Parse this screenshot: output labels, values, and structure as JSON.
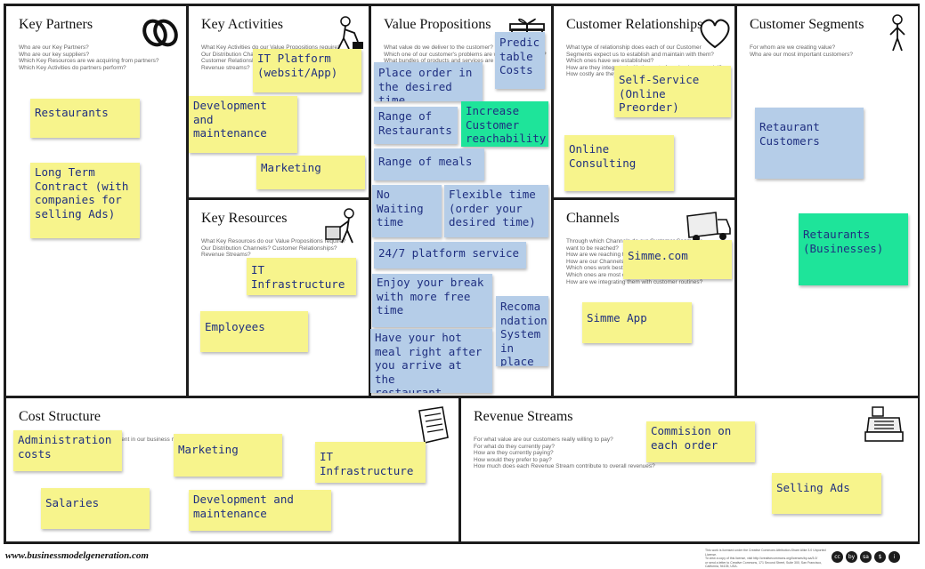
{
  "canvas": {
    "sections": {
      "key_partners": {
        "title": "Key Partners",
        "questions": "Who are our Key Partners?\nWho are our key suppliers?\nWhich Key Resources are we acquiring from partners?\nWhich Key Activities do partners perform?"
      },
      "key_activities": {
        "title": "Key Activities",
        "questions": "What Key Activities do our Value Propositions require?\nOur Distribution Channels?\nCustomer Relationships?\nRevenue streams?"
      },
      "value_propositions": {
        "title": "Value Propositions",
        "questions": "What value do we deliver to the customer?\nWhich one of our customer's problems are we helping to solve?\nWhat bundles of products and services are we offering to each Customer Segment?"
      },
      "customer_relationships": {
        "title": "Customer Relationships",
        "questions": "What type of relationship does each of our Customer\nSegments expect us to establish and maintain with them?\nWhich ones have we established?\nHow are they integrated with the rest of our business model?\nHow costly are they?"
      },
      "customer_segments": {
        "title": "Customer Segments",
        "questions": "For whom are we creating value?\nWho are our most important customers?"
      },
      "key_resources": {
        "title": "Key Resources",
        "questions": "What Key Resources do our Value Propositions require?\nOur Distribution Channels? Customer Relationships?\nRevenue Streams?"
      },
      "channels": {
        "title": "Channels",
        "questions": "Through which Channels do our Customer Segments\nwant to be reached?\nHow are we reaching them now?\nHow are our Channels integrated?\nWhich ones work best?\nWhich ones are most cost-efficient?\nHow are we integrating them with customer routines?"
      },
      "cost_structure": {
        "title": "Cost Structure",
        "questions": "What are the most important costs inherent in our business model?"
      },
      "revenue_streams": {
        "title": "Revenue Streams",
        "questions": "For what value are our customers really willing to pay?\nFor what do they currently pay?\nHow are they currently paying?\nHow would they prefer to pay?\nHow much does each Revenue Stream contribute to overall revenues?"
      }
    },
    "notes": {
      "kp_restaurants": "Restaurants",
      "kp_long_term": "Long Term\nContract (with\ncompanies for\nselling Ads)",
      "ka_it_platform": "IT Platform\n(websit/App)",
      "ka_development": "Development\nand\nmaintenance",
      "ka_marketing": "Marketing",
      "kr_it_infra": "IT Infrastructure",
      "kr_employees": "Employees",
      "vp_predictable": "Predic\ntable\nCosts",
      "vp_place_order": "Place order in\nthe desired time",
      "vp_increase": "Increase\nCustomer\nreachability",
      "vp_range_restaurants": "Range of\nRestaurants",
      "vp_range_meals": "Range of meals",
      "vp_no_waiting": "No\nWaiting\ntime",
      "vp_flexible": "Flexible time\n(order your\ndesired time)",
      "vp_247": "24/7 platform service",
      "vp_enjoy": "Enjoy your break\nwith more free\ntime",
      "vp_recommendation": "Recoma\nndation\nSystem\nin place",
      "vp_hot_meal": "Have your hot\nmeal right after\nyou arrive at the\nrestaurant",
      "cr_self_service": "Self-Service\n(Online Preorder)",
      "cr_online_consulting": "Online\nConsulting",
      "ch_simme_com": "Simme.com",
      "ch_simme_app": "Simme App",
      "cs_restaurant_customers": "Retaurant\nCustomers",
      "cs_restaurants_businesses": "Retaurants\n(Businesses)",
      "cost_admin": "Administration\ncosts",
      "cost_marketing": "Marketing",
      "cost_it_infra": "IT Infrastructure",
      "cost_salaries": "Salaries",
      "cost_development": "Development and\nmaintenance",
      "rev_commision": "Commision on\neach order",
      "rev_selling_ads": "Selling Ads"
    }
  },
  "footer": {
    "url": "www.businessmodelgeneration.com",
    "license": "This work is licensed under the Creative Commons Attribution-Share Alike 3.0 Unported License.\nTo view a copy of this license, visit http://creativecommons.org/licenses/by-sa/3.0/\nor send a letter to Creative Commons, 171 Second Street, Suite 300, San Francisco, California, 94105, USA.",
    "cc_badges": [
      "cc",
      "by",
      "sa",
      "$",
      "i"
    ]
  },
  "colors": {
    "frame": "#1c1c1c",
    "note_yellow": "#f7f48c",
    "note_blue": "#b5cde8",
    "note_green": "#1ee49a",
    "note_text": "#1f2f80"
  },
  "icons": {
    "key_partners": "chain-link-icon",
    "key_activities": "worker-icon",
    "value_propositions": "gift-icon",
    "customer_relationships": "heart-icon",
    "customer_segments": "person-icon",
    "key_resources": "worker-with-box-icon",
    "channels": "truck-icon",
    "cost_structure": "receipt-icon",
    "revenue_streams": "cash-register-icon"
  }
}
